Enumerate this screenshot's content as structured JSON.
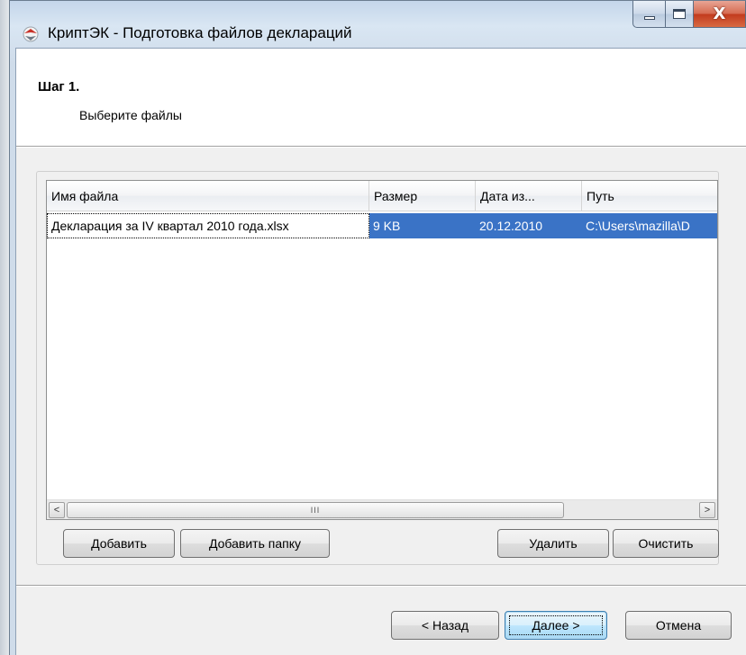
{
  "window": {
    "title": "КриптЭК - Подготовка файлов деклараций",
    "icon": "app-logo-icon",
    "controls": {
      "minimize_icon": "minimize-icon",
      "maximize_icon": "maximize-icon",
      "close_glyph": "X"
    }
  },
  "header": {
    "step_title": "Шаг 1.",
    "step_subtitle": "Выберите файлы"
  },
  "file_table": {
    "columns": [
      "Имя файла",
      "Размер",
      "Дата из...",
      "Путь"
    ],
    "rows": [
      {
        "name": "Декларация за IV квартал 2010 года.xlsx",
        "size": "9 KB",
        "date": "20.12.2010",
        "path": "C:\\Users\\mazilla\\D"
      }
    ],
    "scrollbar": {
      "left_arrow": "<",
      "right_arrow": ">",
      "thumb_grip": "III"
    }
  },
  "file_buttons": {
    "add": "Добавить",
    "add_folder": "Добавить папку",
    "delete": "Удалить",
    "clear": "Очистить"
  },
  "nav_buttons": {
    "back": "< Назад",
    "next": "Далее >",
    "cancel": "Отмена"
  },
  "colors": {
    "selection": "#3a73c6",
    "titlebar": "#c4d6ea",
    "close_button": "#c23a1d",
    "default_button_border": "#3c7fb1"
  }
}
